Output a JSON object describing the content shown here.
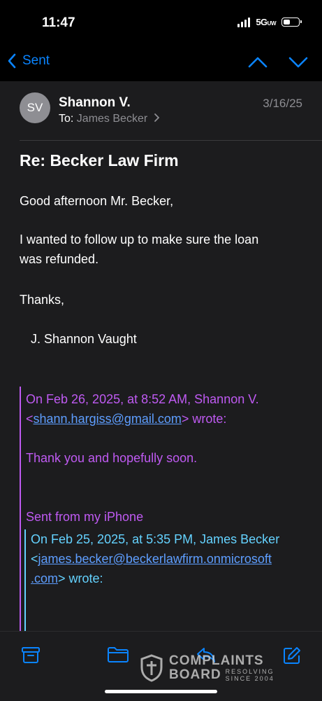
{
  "status_bar": {
    "time": "11:47",
    "network": "5G",
    "network_sup": "UW"
  },
  "nav": {
    "back_label": "Sent"
  },
  "message": {
    "sender_initials": "SV",
    "sender_name": "Shannon V.",
    "date": "3/16/25",
    "to_prefix": "To:",
    "to_name": "James Becker",
    "subject": "Re: Becker Law Firm",
    "greeting": "Good afternoon Mr. Becker,",
    "body_line1": "I wanted to follow up to make sure the loan",
    "body_line2": "was refunded.",
    "thanks": "Thanks,",
    "signature": "J. Shannon Vaught"
  },
  "quote1": {
    "header_line1": "On Feb 26, 2025, at 8:52 AM, Shannon V.",
    "header_lt": "<",
    "email": "shann.hargiss@gmail.com",
    "header_wrote": "> wrote:",
    "text": "Thank you and hopefully soon.",
    "sent_from": "Sent from my iPhone"
  },
  "quote2": {
    "header_line1": "On Feb 25, 2025, at 5:35 PM, James Becker",
    "header_lt": "<",
    "email_part1": "james.becker@beckerlawfirm.onmicrosoft",
    "email_part2": ".com",
    "header_wrote": "> wrote:"
  },
  "watermark": {
    "line1": "COMPLAINTS",
    "line2": "BOARD",
    "tag1": "RESOLVING",
    "tag2": "SINCE 2004"
  },
  "toolbar_icons": [
    "archive-icon",
    "folder-icon",
    "reply-icon",
    "compose-icon"
  ],
  "colors": {
    "accent": "#0a84ff",
    "quote1": "#bf5af2",
    "quote2": "#64d2ff",
    "background": "#1c1c1e"
  }
}
